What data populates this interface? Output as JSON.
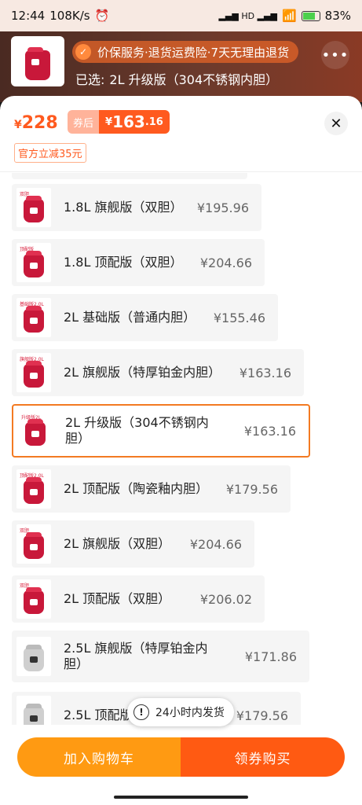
{
  "status": {
    "time": "12:44",
    "speed": "108K/s",
    "signal": "HD",
    "battery": "83%"
  },
  "header": {
    "guarantee": "价保服务·退货运费险·7天无理由退货",
    "selected_prefix": "已选:",
    "selected_value": "2L 升级版（304不锈钢内胆）",
    "more_icon": "more-dots-icon"
  },
  "price": {
    "yen": "¥",
    "original": "228",
    "coupon_label": "券后",
    "coupon_int": "163",
    "coupon_dec": ".16",
    "discount_tag": "官方立减35元"
  },
  "options": [
    {
      "name": "1.8L 旗舰版（双胆）",
      "price": "¥195.96",
      "badge": "双胆",
      "selected": false
    },
    {
      "name": "1.8L 顶配版（双胆）",
      "price": "¥204.66",
      "badge": "顶配版",
      "selected": false
    },
    {
      "name": "2L 基础版（普通内胆）",
      "price": "¥155.46",
      "badge": "基础版2.0L",
      "selected": false
    },
    {
      "name": "2L 旗舰版（特厚铂金内胆）",
      "price": "¥163.16",
      "badge": "旗舰版2.0L",
      "selected": false
    },
    {
      "name": "2L 升级版（304不锈钢内胆）",
      "price": "¥163.16",
      "badge": "升级版2L",
      "selected": true
    },
    {
      "name": "2L 顶配版（陶瓷釉内胆）",
      "price": "¥179.56",
      "badge": "顶配版2.0L",
      "selected": false
    },
    {
      "name": "2L 旗舰版（双胆）",
      "price": "¥204.66",
      "badge": "双胆",
      "selected": false
    },
    {
      "name": "2L 顶配版（双胆）",
      "price": "¥206.02",
      "badge": "双胆",
      "selected": false
    },
    {
      "name": "2.5L 旗舰版（特厚铂金内胆）",
      "price": "¥171.86",
      "badge": "",
      "selected": false
    },
    {
      "name": "2.5L 顶配版",
      "price": "¥179.56",
      "badge": "",
      "selected": false
    }
  ],
  "toast": "24小时内发货",
  "actions": {
    "cart": "加入购物车",
    "buy": "领券购买"
  },
  "colors": {
    "accent": "#ff5a1f",
    "cart": "#ff9a12",
    "buy": "#ff5a12",
    "selected_border": "#f37a22"
  }
}
